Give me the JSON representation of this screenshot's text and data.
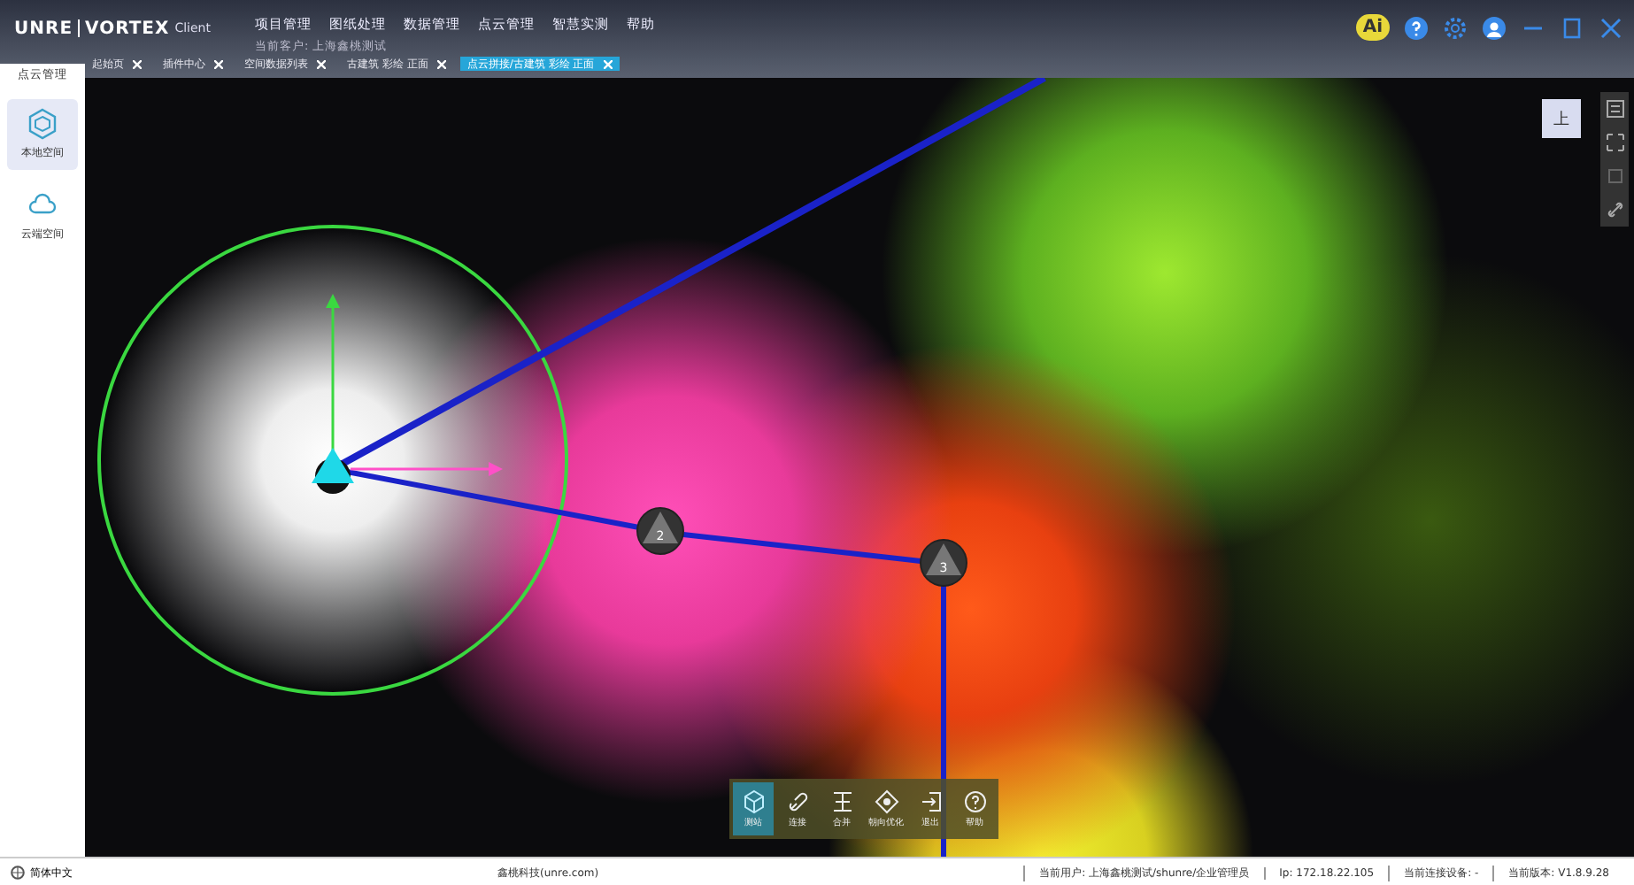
{
  "app": {
    "logo": "UNRE",
    "logo_suffix": "VORTEX",
    "edition": "Client",
    "customer": "当前客户: 上海鑫桃测试"
  },
  "menu": [
    "项目管理",
    "图纸处理",
    "数据管理",
    "点云管理",
    "智慧实测",
    "帮助"
  ],
  "tabs": [
    {
      "label": "起始页",
      "selected": false
    },
    {
      "label": "插件中心",
      "selected": false
    },
    {
      "label": "空间数据列表",
      "selected": false
    },
    {
      "label": "古建筑 彩绘 正面",
      "selected": false
    },
    {
      "label": "点云拼接/古建筑 彩绘 正面",
      "selected": true
    }
  ],
  "sidebar": {
    "title": "点云管理",
    "items": [
      {
        "label": "本地空间",
        "kind": "local",
        "selected": true
      },
      {
        "label": "云端空间",
        "kind": "cloud",
        "selected": false
      }
    ]
  },
  "ai_badge": "Ai",
  "view_button": "上",
  "stations": [
    {
      "kind": "active"
    },
    {
      "label": "2",
      "kind": "normal"
    },
    {
      "label": "3",
      "kind": "normal"
    }
  ],
  "tools": [
    {
      "label": "测站",
      "kind": "station",
      "selected": true
    },
    {
      "label": "连接",
      "kind": "link",
      "selected": false
    },
    {
      "label": "合并",
      "kind": "merge",
      "selected": false
    },
    {
      "label": "朝向优化",
      "kind": "orient",
      "selected": false
    },
    {
      "label": "退出",
      "kind": "exit",
      "selected": false
    },
    {
      "label": "帮助",
      "kind": "help",
      "selected": false
    }
  ],
  "status_bar": {
    "language": "简体中文",
    "company": "鑫桃科技(unre.com)",
    "items": [
      "当前用户: 上海鑫桃测试/shunre/企业管理员",
      "Ip: 172.18.22.105",
      "当前连接设备: -",
      "当前版本: V1.8.9.28"
    ]
  }
}
